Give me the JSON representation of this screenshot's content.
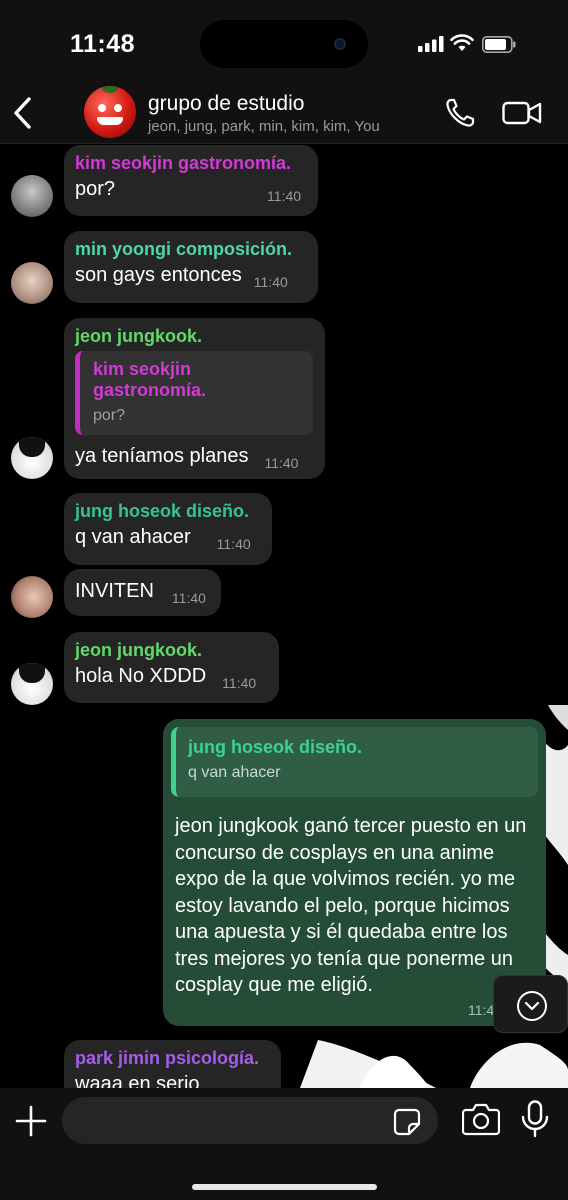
{
  "status_bar": {
    "time": "11:48"
  },
  "header": {
    "title": "grupo de estudio",
    "members": "jeon, jung, park, min, kim, kim, You"
  },
  "messages": [
    {
      "sender": "kim seokjin gastronomía.",
      "sender_color": "#d23ad6",
      "text": "por?",
      "time": "11:40"
    },
    {
      "sender": "min yoongi composición.",
      "sender_color": "#4fd7a2",
      "text": "son gays entonces",
      "time": "11:40"
    },
    {
      "sender": "jeon jungkook.",
      "sender_color": "#61d96a",
      "quote_sender": "kim seokjin gastronomía.",
      "quote_text": "por?",
      "text": "ya teníamos planes",
      "time": "11:40"
    },
    {
      "sender": "jung hoseok diseño.",
      "sender_color": "#33c29a",
      "text": "q van ahacer",
      "time": "11:40"
    },
    {
      "text": "INVITEN",
      "time": "11:40"
    },
    {
      "sender": "jeon jungkook.",
      "sender_color": "#61d96a",
      "text": "hola No XDDD",
      "time": "11:40"
    },
    {
      "sender": "park jimin psicología.",
      "sender_color": "#a55ce8",
      "text": "waaa en serio"
    }
  ],
  "outgoing": {
    "quote_sender": "jung hoseok diseño.",
    "quote_text": "q van ahacer",
    "text": "jeon jungkook ganó tercer puesto en un concurso de cosplays en una anime expo de la que volvimos recién. yo me estoy lavando el pelo, porque hicimos una apuesta y si él quedaba entre los tres mejores yo tenía que ponerme un cosplay que me eligió.",
    "time": "11:40"
  },
  "composer": {
    "placeholder": ""
  },
  "colors": {
    "accent_outgoing": "#244c37",
    "incoming_bubble": "#252525"
  },
  "icons": [
    "back-chevron-icon",
    "phone-icon",
    "video-camera-icon",
    "chevron-down-icon",
    "plus-icon",
    "sticker-icon",
    "camera-icon",
    "microphone-icon"
  ]
}
